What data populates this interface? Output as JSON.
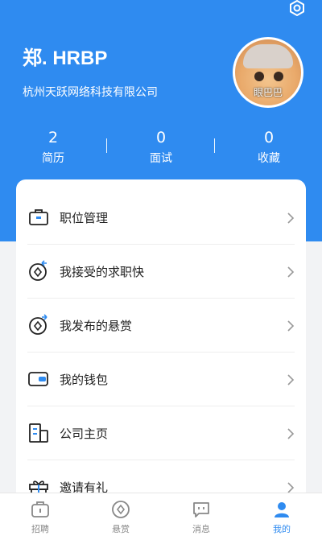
{
  "profile": {
    "name": "郑. HRBP",
    "company": "杭州天跃网络科技有限公司",
    "avatar_tag": "眼巴巴"
  },
  "stats": [
    {
      "value": "2",
      "label": "简历"
    },
    {
      "value": "0",
      "label": "面试"
    },
    {
      "value": "0",
      "label": "收藏"
    }
  ],
  "menu": [
    {
      "label": "职位管理",
      "icon": "briefcase-icon"
    },
    {
      "label": "我接受的求职快",
      "icon": "coin-arrow-in-icon"
    },
    {
      "label": "我发布的悬赏",
      "icon": "coin-arrow-out-icon"
    },
    {
      "label": "我的钱包",
      "icon": "wallet-icon"
    },
    {
      "label": "公司主页",
      "icon": "building-icon"
    },
    {
      "label": "邀请有礼",
      "icon": "gift-icon"
    }
  ],
  "tabs": [
    {
      "label": "招聘",
      "icon": "briefcase-icon"
    },
    {
      "label": "悬赏",
      "icon": "bounty-icon"
    },
    {
      "label": "消息",
      "icon": "message-icon"
    },
    {
      "label": "我的",
      "icon": "person-icon",
      "active": true
    }
  ],
  "colors": {
    "accent": "#2f8bf0",
    "tab_inactive": "#888888"
  }
}
